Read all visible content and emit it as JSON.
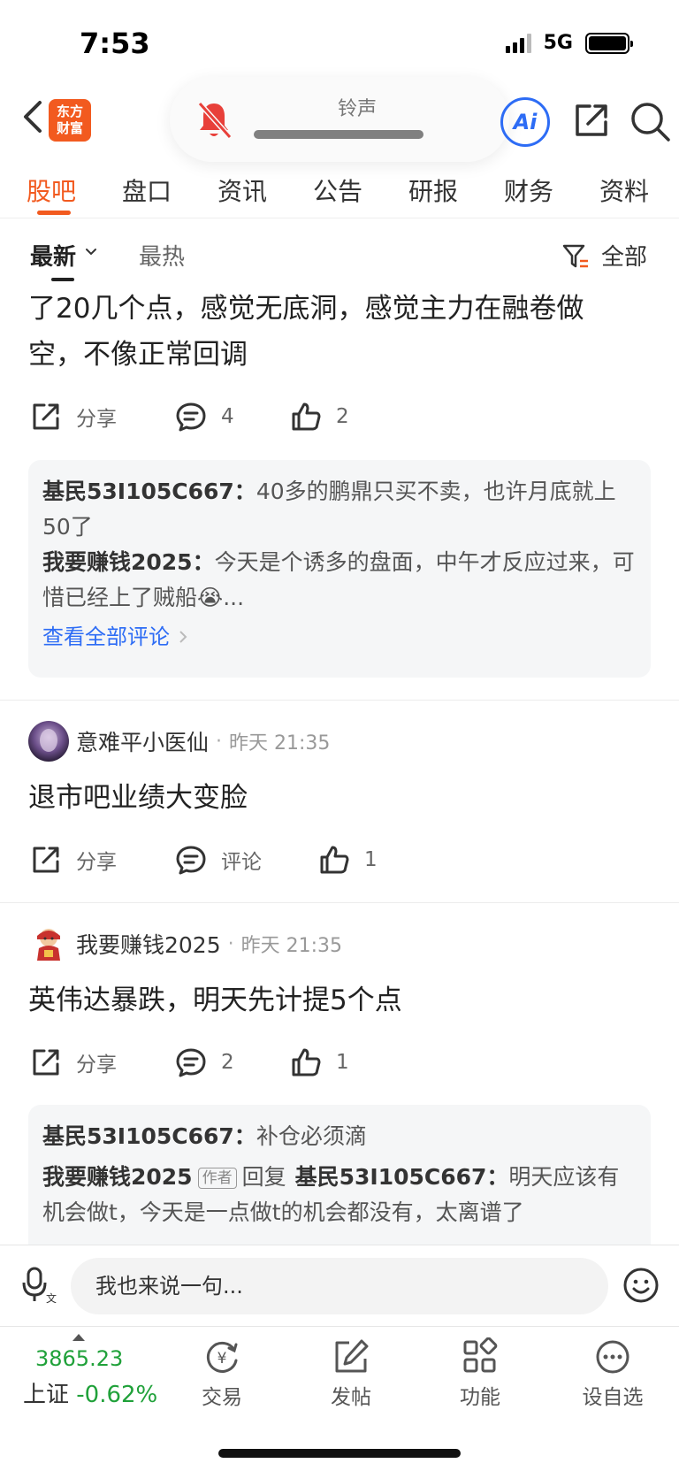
{
  "status_bar": {
    "time": "7:53",
    "network": "5G"
  },
  "nav": {
    "logo_line1": "东方",
    "logo_line2": "财富",
    "ringer_label": "铃声",
    "ai_label": "Ai"
  },
  "tabs": [
    "股吧",
    "盘口",
    "资讯",
    "公告",
    "研报",
    "财务",
    "资料"
  ],
  "sort": {
    "latest": "最新",
    "hot": "最热",
    "filter_label": "全部"
  },
  "posts": [
    {
      "text_line1": "了20几个点，感觉无底洞，感觉主力在融卷做",
      "text_line2": "空，不像正常回调",
      "share_label": "分享",
      "comment_count": "4",
      "like_count": "2",
      "comments": [
        {
          "user": "基民53I105C667：",
          "text": "40多的鹏鼎只买不卖，也许月底就上50了"
        },
        {
          "user": "我要赚钱2025：",
          "text": "今天是个诱多的盘面，中午才反应过来，可惜已经上了贼船😭..."
        }
      ],
      "view_all": "查看全部评论"
    },
    {
      "author": "意难平小医仙",
      "time": "昨天 21:35",
      "text": "退市吧业绩大变脸",
      "share_label": "分享",
      "comment_label": "评论",
      "like_count": "1"
    },
    {
      "author": "我要赚钱2025",
      "time": "昨天 21:35",
      "text": "英伟达暴跌，明天先计提5个点",
      "share_label": "分享",
      "comment_count": "2",
      "like_count": "1",
      "comments": [
        {
          "user": "基民53I105C667：",
          "text": "补仓必须滴"
        },
        {
          "user": "我要赚钱2025",
          "author_tag": "作者",
          "reply_word": "回复",
          "reply_to": "基民53I105C667：",
          "text": "明天应该有机会做t，今天是一点做t的机会都没有，太离谱了"
        }
      ]
    }
  ],
  "input": {
    "placeholder": "我也来说一句..."
  },
  "bottom_bar": {
    "index_value": "3865.23",
    "index_name": "上证",
    "index_change": "-0.62%",
    "items": [
      "交易",
      "发帖",
      "功能",
      "设自选"
    ]
  },
  "colors": {
    "brand": "#f25a1f",
    "link": "#2d6cf5",
    "down": "#20a13a"
  }
}
